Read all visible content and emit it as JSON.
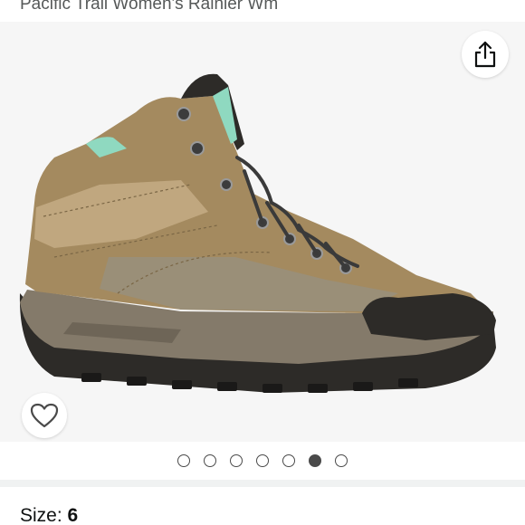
{
  "product": {
    "title": "Pacific Trail Women's Rainier Wm"
  },
  "gallery": {
    "image_alt_icon": "boot-image",
    "share_icon": "share-icon",
    "wishlist_icon": "heart-icon",
    "dot_count": 7,
    "active_index": 5
  },
  "size": {
    "label": "Size:",
    "value": "6"
  },
  "colors": {
    "boot_tan": "#a48a5f",
    "boot_dark": "#2d2b28",
    "accent_mint": "#8fd9c0",
    "dot": "#4a4a4a"
  }
}
